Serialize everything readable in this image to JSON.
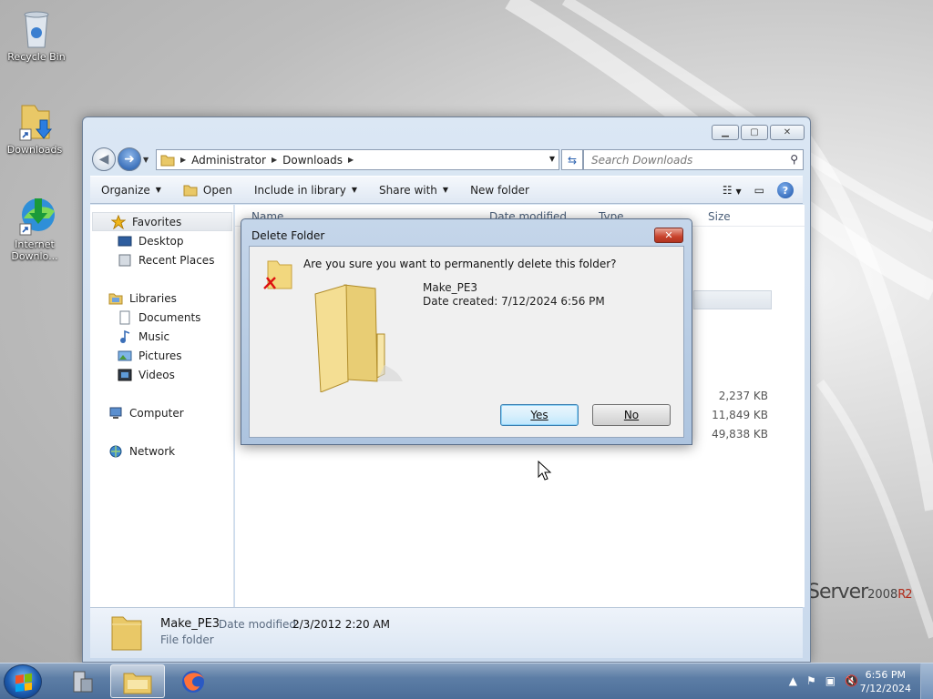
{
  "desktop": {
    "icons": [
      {
        "label": "Recycle Bin",
        "icon": "recycle-bin-icon"
      },
      {
        "label": "Downloads",
        "icon": "folder-shortcut-icon"
      },
      {
        "label": "Internet Downlo...",
        "icon": "idm-icon"
      }
    ],
    "brand": {
      "text": "Server",
      "version": "2008",
      "edition": "R2"
    }
  },
  "explorer": {
    "address": {
      "segments": [
        "Administrator",
        "Downloads"
      ]
    },
    "search": {
      "placeholder": "Search Downloads"
    },
    "toolbar": {
      "organize": "Organize",
      "open": "Open",
      "include_in_library": "Include in library",
      "share_with": "Share with",
      "new_folder": "New folder"
    },
    "nav": {
      "favorites": "Favorites",
      "favorites_items": [
        "Desktop",
        "Recent Places"
      ],
      "libraries": "Libraries",
      "libraries_items": [
        "Documents",
        "Music",
        "Pictures",
        "Videos"
      ],
      "computer": "Computer",
      "network": "Network"
    },
    "columns": {
      "name": "Name",
      "date_modified": "Date modified",
      "type": "Type",
      "size": "Size"
    },
    "file_sizes": [
      "2,237 KB",
      "11,849 KB",
      "49,838 KB"
    ],
    "details_pane": {
      "name": "Make_PE3",
      "modified_label": "Date modified:",
      "modified_value": "2/3/2012 2:20 AM",
      "type": "File folder"
    }
  },
  "dialog": {
    "title": "Delete Folder",
    "question": "Are you sure you want to permanently delete this folder?",
    "folder_name": "Make_PE3",
    "date_created": "Date created: 7/12/2024 6:56 PM",
    "yes": "Yes",
    "no": "No"
  },
  "taskbar": {
    "time": "6:56 PM",
    "date": "7/12/2024"
  },
  "colors": {
    "accent": "#1d54a8",
    "close_red": "#c8422c",
    "taskbar": "#5d7ea6"
  }
}
